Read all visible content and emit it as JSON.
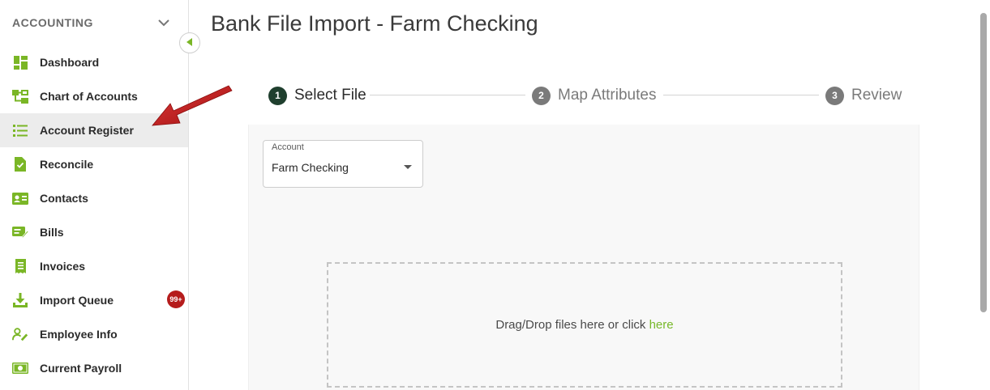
{
  "sidebar": {
    "title": "ACCOUNTING",
    "items": [
      {
        "label": "Dashboard",
        "icon": "dashboard-icon"
      },
      {
        "label": "Chart of Accounts",
        "icon": "hierarchy-icon"
      },
      {
        "label": "Account Register",
        "icon": "list-icon",
        "active": true
      },
      {
        "label": "Reconcile",
        "icon": "document-check-icon"
      },
      {
        "label": "Contacts",
        "icon": "contact-card-icon"
      },
      {
        "label": "Bills",
        "icon": "bill-edit-icon"
      },
      {
        "label": "Invoices",
        "icon": "receipt-icon"
      },
      {
        "label": "Import Queue",
        "icon": "download-icon",
        "badge": "99+"
      },
      {
        "label": "Employee Info",
        "icon": "user-edit-icon"
      },
      {
        "label": "Current Payroll",
        "icon": "money-icon"
      }
    ]
  },
  "page": {
    "title": "Bank File Import - Farm Checking"
  },
  "stepper": {
    "steps": [
      {
        "num": "1",
        "label": "Select File",
        "state": "active"
      },
      {
        "num": "2",
        "label": "Map Attributes",
        "state": "inactive"
      },
      {
        "num": "3",
        "label": "Review",
        "state": "inactive"
      }
    ]
  },
  "account_select": {
    "label": "Account",
    "value": "Farm Checking"
  },
  "dropzone": {
    "text": "Drag/Drop files here or click ",
    "link": "here"
  },
  "colors": {
    "accent_green": "#78b82a",
    "icon_green": "#7ab626",
    "active_step": "#1f3f2e",
    "badge_red": "#b51c1c",
    "arrow_red": "#c41818"
  }
}
